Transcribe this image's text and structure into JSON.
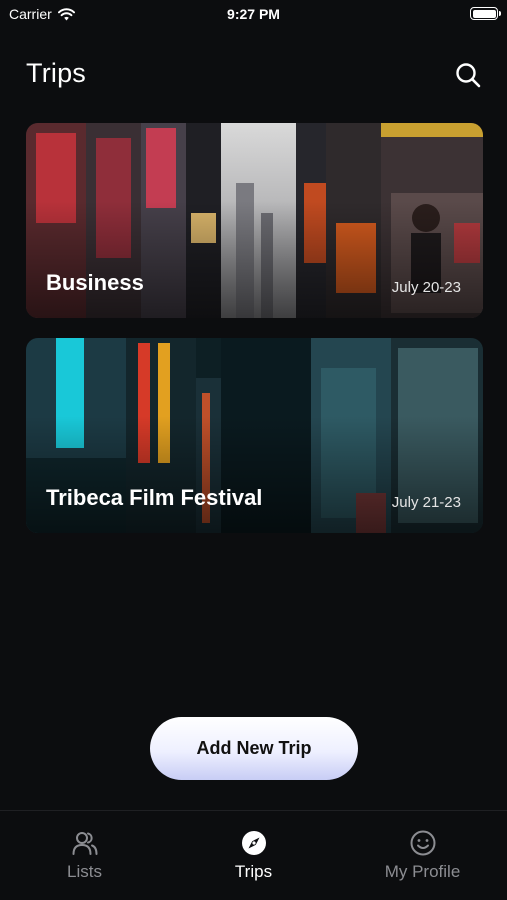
{
  "status_bar": {
    "carrier": "Carrier",
    "time": "9:27 PM"
  },
  "header": {
    "title": "Trips",
    "search_icon": "search-icon"
  },
  "trips": [
    {
      "title": "Business",
      "dates": "July 20-23"
    },
    {
      "title": "Tribeca Film Festival",
      "dates": "July 21-23"
    }
  ],
  "add_button": {
    "label": "Add New Trip"
  },
  "tab_bar": {
    "tabs": [
      {
        "label": "Lists",
        "icon": "users-icon",
        "active": false
      },
      {
        "label": "Trips",
        "icon": "compass-icon",
        "active": true
      },
      {
        "label": "My Profile",
        "icon": "smiley-icon",
        "active": false
      }
    ]
  },
  "colors": {
    "background": "#0c0d0f",
    "inactive_tab": "#8c8d92",
    "active_tab": "#ffffff"
  }
}
